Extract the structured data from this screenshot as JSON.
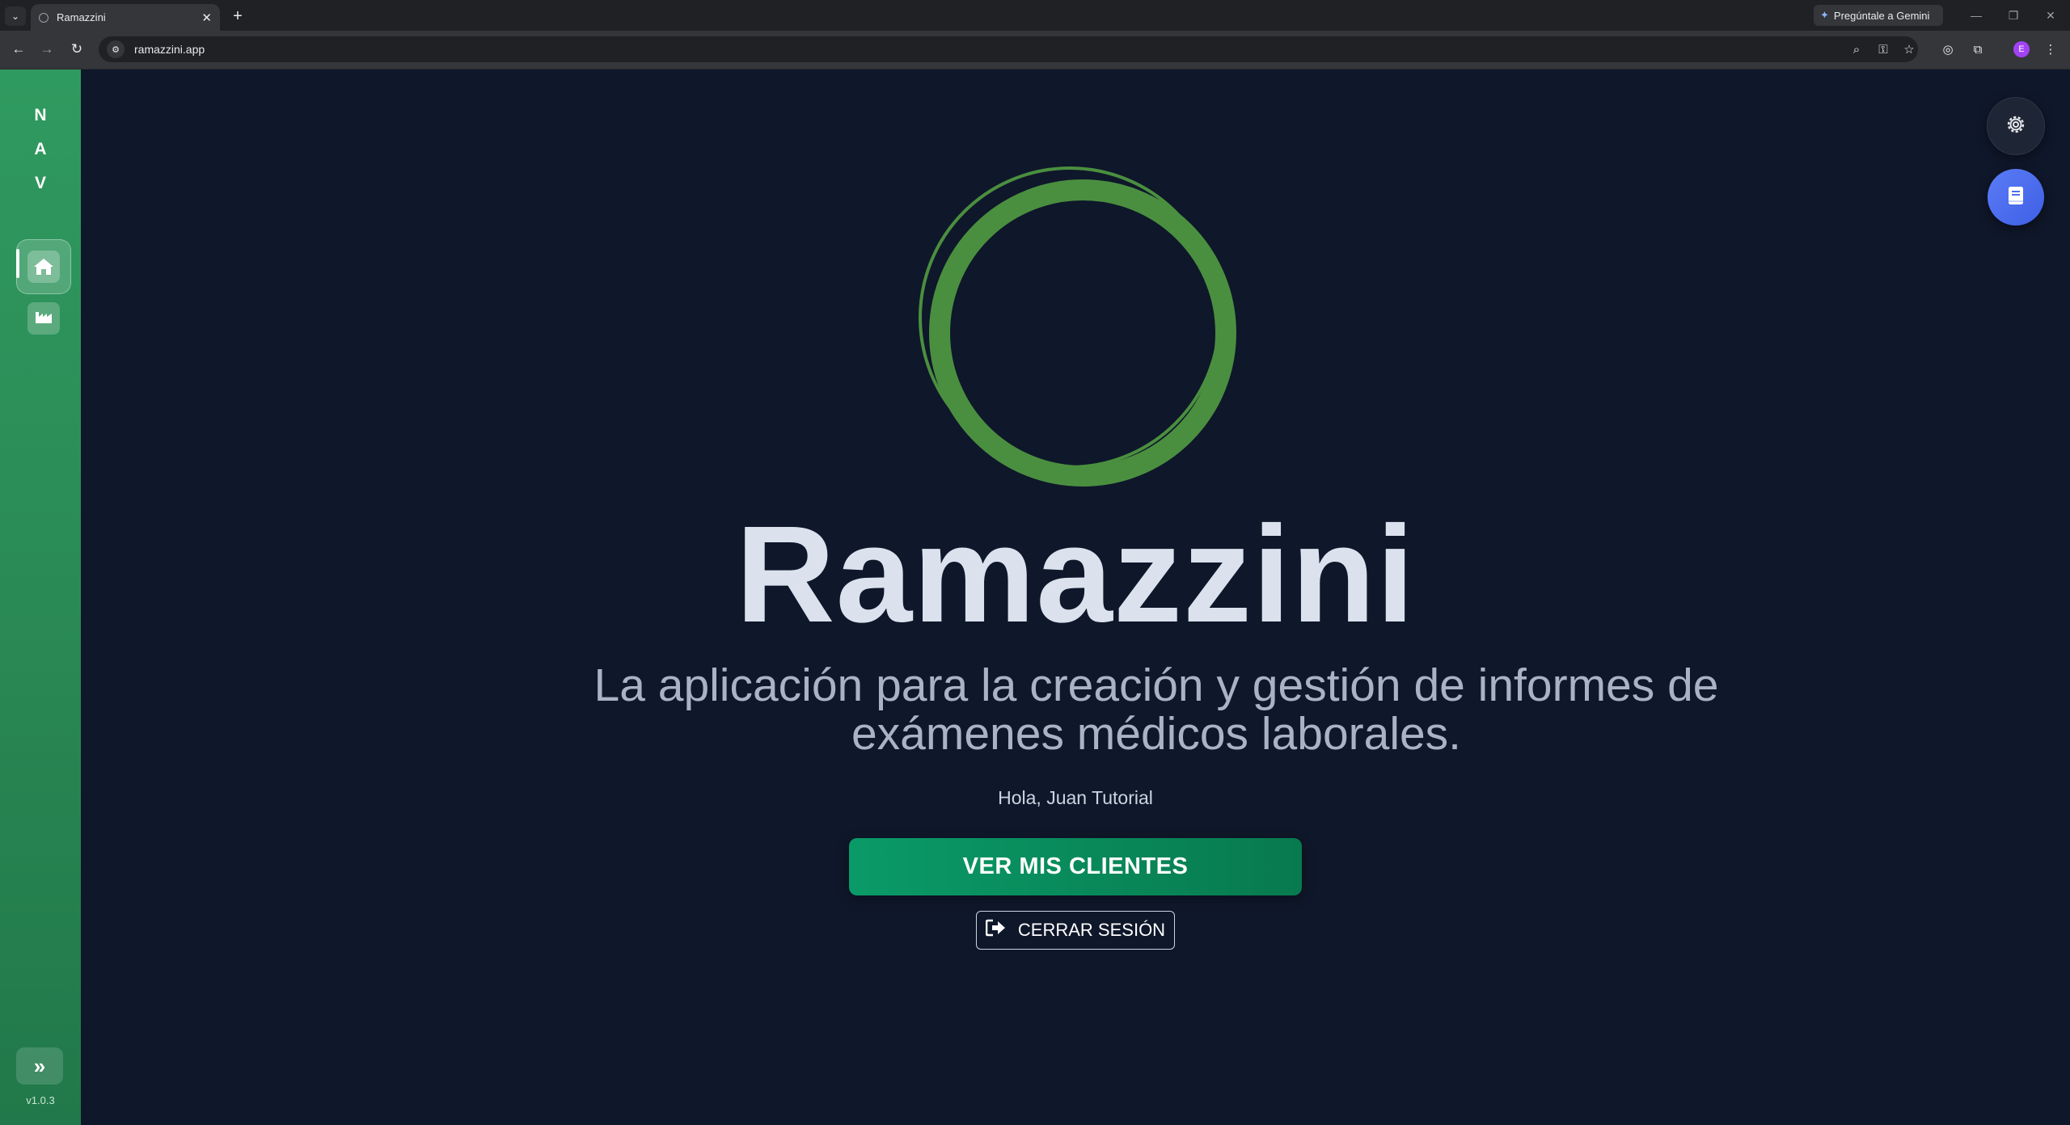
{
  "browser": {
    "tab_title": "Ramazzini",
    "tab_close": "✕",
    "new_tab": "+",
    "gemini_label": "Pregúntale a Gemini",
    "url": "ramazzini.app",
    "profile_initial": "E"
  },
  "sidebar": {
    "nav_letters": [
      "N",
      "A",
      "V"
    ],
    "items": [
      {
        "icon": "home-icon",
        "active": true
      },
      {
        "icon": "factory-icon",
        "active": false
      }
    ],
    "expand_icon": "»",
    "version": "v1.0.3"
  },
  "main": {
    "brand": "Ramazzini",
    "tagline_line1": "La aplicación para la creación y gestión de informes de",
    "tagline_line2": "exámenes médicos laborales.",
    "greeting": "Hola, Juan Tutorial",
    "primary_button": "VER MIS CLIENTES",
    "logout_button": "CERRAR SESIÓN"
  },
  "colors": {
    "background": "#0f172a",
    "sidebar": "#2a8a55",
    "logo_ring": "#4a8f3f",
    "primary_button": "#0a9a68",
    "fab_book": "#4f6ef0"
  }
}
